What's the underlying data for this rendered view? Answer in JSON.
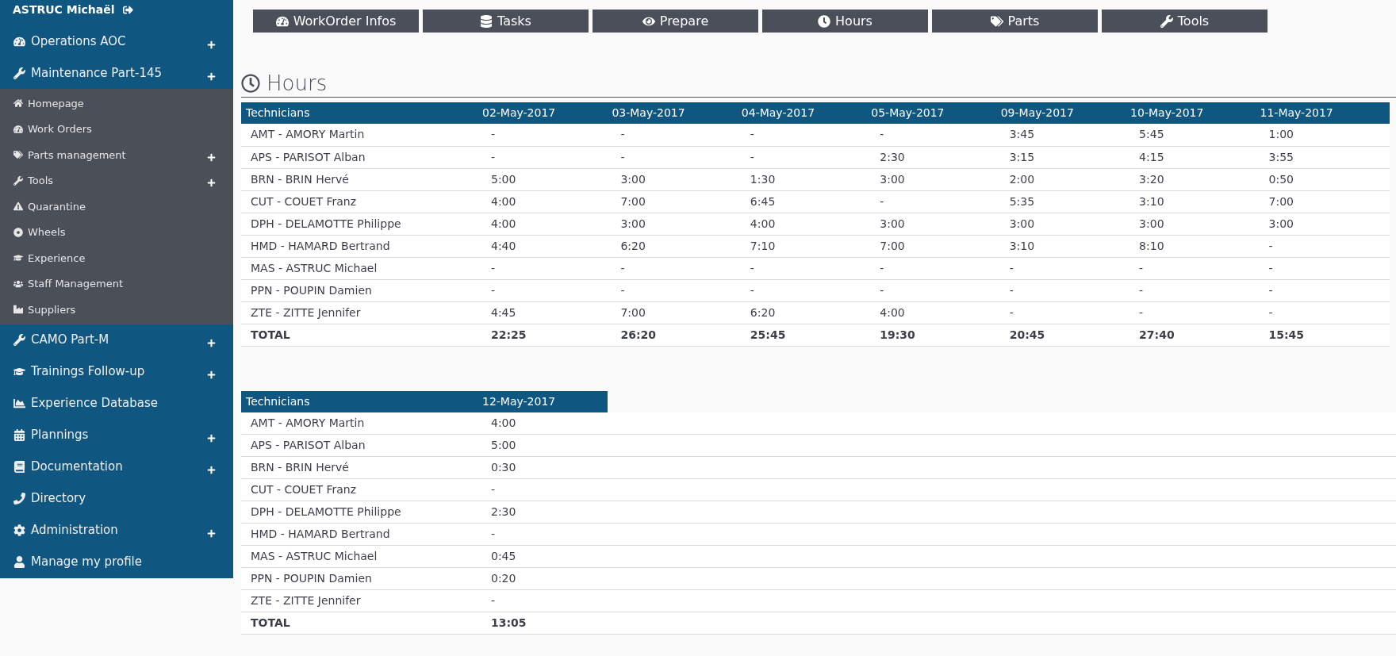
{
  "sidebar": {
    "user": {
      "name": "ASTRUC Michaël"
    },
    "items": [
      {
        "label": "Operations AOC",
        "expandable": true
      },
      {
        "label": "Maintenance Part-145",
        "expandable": true,
        "children": [
          {
            "label": "Homepage",
            "expandable": false
          },
          {
            "label": "Work Orders",
            "expandable": false
          },
          {
            "label": "Parts management",
            "expandable": true
          },
          {
            "label": "Tools",
            "expandable": true
          },
          {
            "label": "Quarantine",
            "expandable": false
          },
          {
            "label": "Wheels",
            "expandable": false
          },
          {
            "label": "Experience",
            "expandable": false
          },
          {
            "label": "Staff Management",
            "expandable": false
          },
          {
            "label": "Suppliers",
            "expandable": false
          }
        ]
      },
      {
        "label": "CAMO Part-M",
        "expandable": true
      },
      {
        "label": "Trainings Follow-up",
        "expandable": true
      },
      {
        "label": "Experience Database",
        "expandable": false
      },
      {
        "label": "Plannings",
        "expandable": true
      },
      {
        "label": "Documentation",
        "expandable": true
      },
      {
        "label": "Directory",
        "expandable": false
      },
      {
        "label": "Administration",
        "expandable": true
      },
      {
        "label": "Manage my profile",
        "expandable": false
      }
    ]
  },
  "tabs": [
    "WorkOrder Infos",
    "Tasks",
    "Prepare",
    "Hours",
    "Parts",
    "Tools"
  ],
  "section": {
    "title": "Hours"
  },
  "tables": [
    {
      "columns": [
        "Technicians",
        "02-May-2017",
        "03-May-2017",
        "04-May-2017",
        "05-May-2017",
        "09-May-2017",
        "10-May-2017",
        "11-May-2017"
      ],
      "rows": [
        [
          "AMT - AMORY Martin",
          "-",
          "-",
          "-",
          "-",
          "3:45",
          "5:45",
          "1:00"
        ],
        [
          "APS - PARISOT Alban",
          "-",
          "-",
          "-",
          "2:30",
          "3:15",
          "4:15",
          "3:55"
        ],
        [
          "BRN - BRIN Hervé",
          "5:00",
          "3:00",
          "1:30",
          "3:00",
          "2:00",
          "3:20",
          "0:50"
        ],
        [
          "CUT - COUET Franz",
          "4:00",
          "7:00",
          "6:45",
          "-",
          "5:35",
          "3:10",
          "7:00"
        ],
        [
          "DPH - DELAMOTTE Philippe",
          "4:00",
          "3:00",
          "4:00",
          "3:00",
          "3:00",
          "3:00",
          "3:00"
        ],
        [
          "HMD - HAMARD Bertrand",
          "4:40",
          "6:20",
          "7:10",
          "7:00",
          "3:10",
          "8:10",
          "-"
        ],
        [
          "MAS - ASTRUC Michael",
          "-",
          "-",
          "-",
          "-",
          "-",
          "-",
          "-"
        ],
        [
          "PPN - POUPIN Damien",
          "-",
          "-",
          "-",
          "-",
          "-",
          "-",
          "-"
        ],
        [
          "ZTE - ZITTE Jennifer",
          "4:45",
          "7:00",
          "6:20",
          "4:00",
          "-",
          "-",
          "-"
        ]
      ],
      "total": [
        "TOTAL",
        "22:25",
        "26:20",
        "25:45",
        "19:30",
        "20:45",
        "27:40",
        "15:45"
      ]
    },
    {
      "columns": [
        "Technicians",
        "12-May-2017"
      ],
      "rows": [
        [
          "AMT - AMORY Martin",
          "4:00"
        ],
        [
          "APS - PARISOT Alban",
          "5:00"
        ],
        [
          "BRN - BRIN Hervé",
          "0:30"
        ],
        [
          "CUT - COUET Franz",
          "-"
        ],
        [
          "DPH - DELAMOTTE Philippe",
          "2:30"
        ],
        [
          "HMD - HAMARD Bertrand",
          "-"
        ],
        [
          "MAS - ASTRUC Michael",
          "0:45"
        ],
        [
          "PPN - POUPIN Damien",
          "0:20"
        ],
        [
          "ZTE - ZITTE Jennifer",
          "-"
        ]
      ],
      "total": [
        "TOTAL",
        "13:05"
      ]
    }
  ]
}
